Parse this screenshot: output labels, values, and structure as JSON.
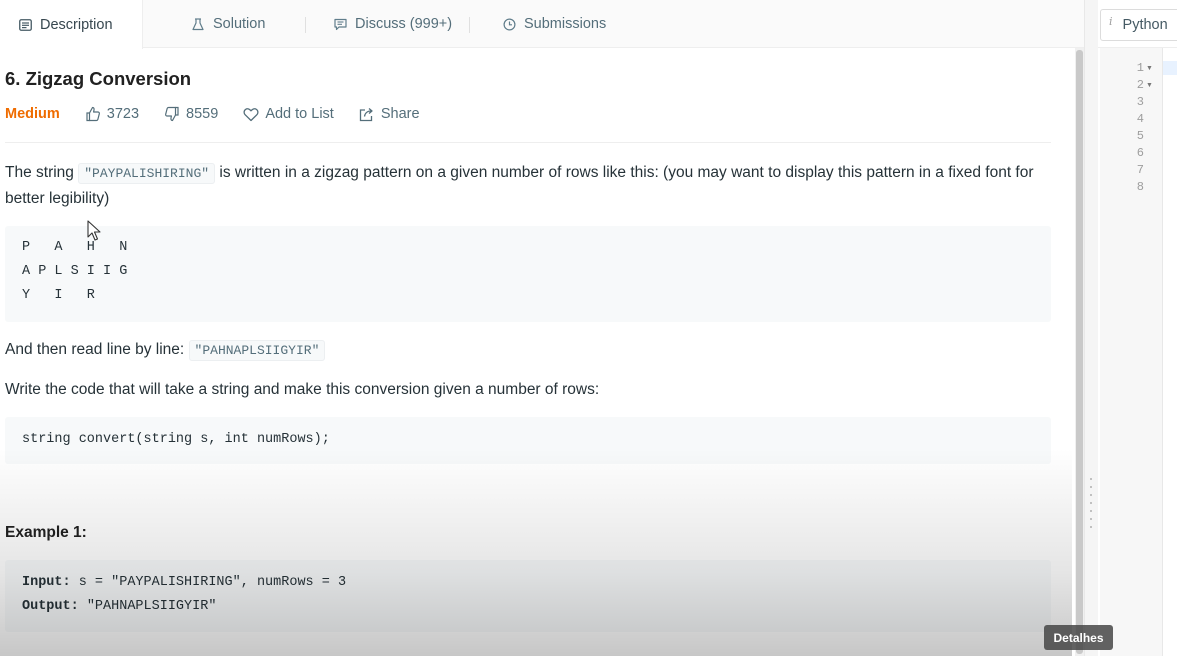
{
  "tabs": [
    {
      "label": "Description",
      "icon": "description-icon"
    },
    {
      "label": "Solution",
      "icon": "flask-icon"
    },
    {
      "label": "Discuss (999+)",
      "icon": "discuss-icon"
    },
    {
      "label": "Submissions",
      "icon": "clock-icon"
    }
  ],
  "problem": {
    "title": "6. Zigzag Conversion",
    "difficulty": "Medium",
    "difficulty_color": "#ef6c00",
    "likes": "3723",
    "dislikes": "8559",
    "add_to_list": "Add to List",
    "share": "Share"
  },
  "description": {
    "p1_before": "The string ",
    "p1_code": "\"PAYPALISHIRING\"",
    "p1_after": " is written in a zigzag pattern on a given number of rows like this: (you may want to display this pattern in a fixed font for better legibility)",
    "zigzag_lines": [
      "P   A   H   N",
      "A P L S I I G",
      "Y   I   R"
    ],
    "p2_before": "And then read line by line: ",
    "p2_code": "\"PAHNAPLSIIGYIR\"",
    "p3": "Write the code that will take a string and make this conversion given a number of rows:",
    "signature": "string convert(string s, int numRows);"
  },
  "example1": {
    "title": "Example 1:",
    "input_label": "Input:",
    "input_value": " s = \"PAYPALISHIRING\", numRows = 3",
    "output_label": "Output:",
    "output_value": " \"PAHNAPLSIIGYIR\""
  },
  "editor": {
    "language": "Python",
    "line_numbers": [
      "1",
      "2",
      "3",
      "4",
      "5",
      "6",
      "7",
      "8"
    ]
  },
  "overlay": {
    "details_label": "Detalhes"
  }
}
